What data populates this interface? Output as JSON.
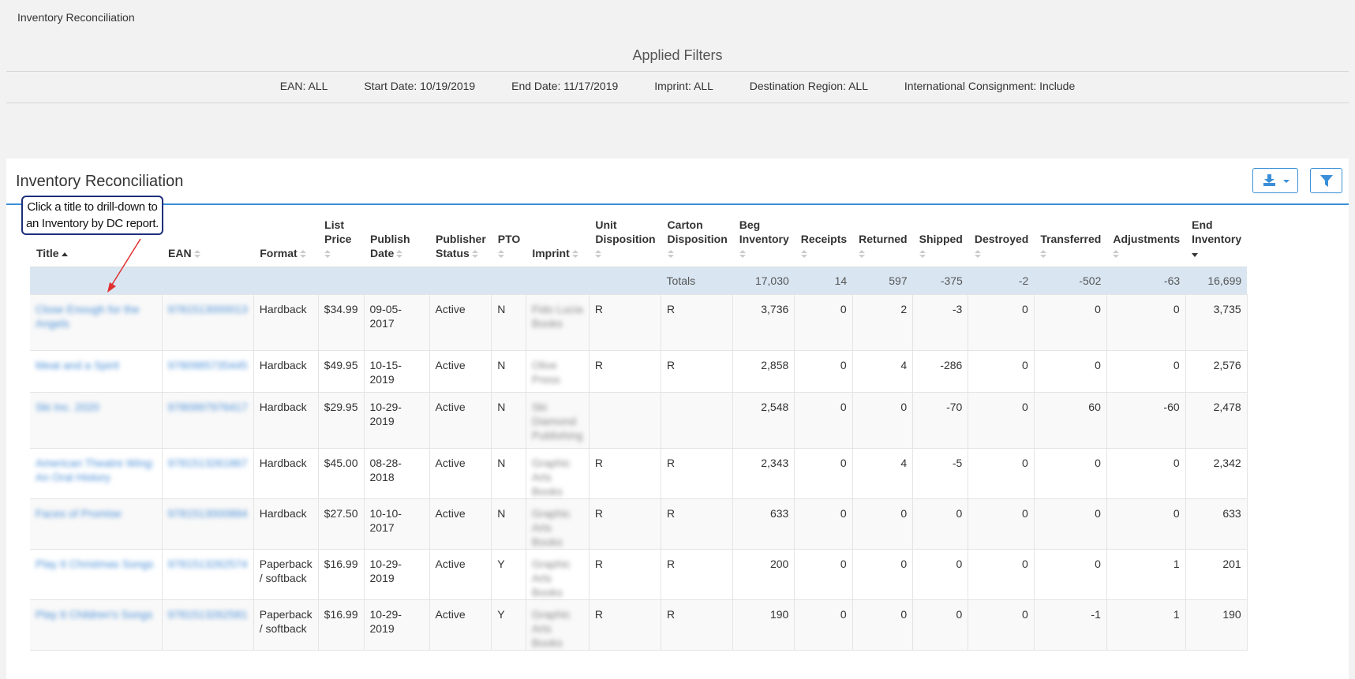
{
  "page": {
    "title": "Inventory Reconciliation",
    "filters_title": "Applied Filters",
    "filters": [
      "EAN: ALL",
      "Start Date: 10/19/2019",
      "End Date: 11/17/2019",
      "Imprint: ALL",
      "Destination Region: ALL",
      "International Consignment: Include"
    ]
  },
  "panel": {
    "title": "Inventory Reconciliation",
    "export_icon": "download-icon",
    "filter_icon": "filter-funnel-icon"
  },
  "callout": {
    "text": "Click a title to drill-down to an Inventory by DC report."
  },
  "table": {
    "headers": {
      "title": "Title",
      "ean": "EAN",
      "format": "Format",
      "list_price": "List Price",
      "publish_date": "Publish Date",
      "publisher_status": "Publisher Status",
      "pto": "PTO",
      "imprint": "Imprint",
      "unit_disposition": "Unit Disposition",
      "carton_disposition": "Carton Disposition",
      "beg_inventory": "Beg Inventory",
      "receipts": "Receipts",
      "returned": "Returned",
      "shipped": "Shipped",
      "destroyed": "Destroyed",
      "transferred": "Transferred",
      "adjustments": "Adjustments",
      "end_inventory": "End Inventory"
    },
    "totals": {
      "label": "Totals",
      "beg_inventory": "17,030",
      "receipts": "14",
      "returned": "597",
      "shipped": "-375",
      "destroyed": "-2",
      "transferred": "-502",
      "adjustments": "-63",
      "end_inventory": "16,699"
    },
    "rows": [
      {
        "title": "Close Enough for the Angels",
        "ean": "9781513000013",
        "format": "Hardback",
        "list_price": "$34.99",
        "publish_date": "09-05-2017",
        "status": "Active",
        "pto": "N",
        "imprint": "Fido Lucia Books",
        "unit": "R",
        "carton": "R",
        "beg": "3,736",
        "receipts": "0",
        "returned": "2",
        "shipped": "-3",
        "destroyed": "0",
        "transferred": "0",
        "adjustments": "0",
        "end": "3,735"
      },
      {
        "title": "Meat and a Spirit",
        "ean": "9780985735445",
        "format": "Hardback",
        "list_price": "$49.95",
        "publish_date": "10-15-2019",
        "status": "Active",
        "pto": "N",
        "imprint": "Olive Press",
        "unit": "R",
        "carton": "R",
        "beg": "2,858",
        "receipts": "0",
        "returned": "4",
        "shipped": "-286",
        "destroyed": "0",
        "transferred": "0",
        "adjustments": "0",
        "end": "2,576"
      },
      {
        "title": "Ski Inc. 2020",
        "ean": "9780997976417",
        "format": "Hardback",
        "list_price": "$29.95",
        "publish_date": "10-29-2019",
        "status": "Active",
        "pto": "N",
        "imprint": "Ski Diamond Publishing",
        "unit": "",
        "carton": "",
        "beg": "2,548",
        "receipts": "0",
        "returned": "0",
        "shipped": "-70",
        "destroyed": "0",
        "transferred": "60",
        "adjustments": "-60",
        "end": "2,478"
      },
      {
        "title": "American Theatre Wing: An Oral History",
        "ean": "9781513261867",
        "format": "Hardback",
        "list_price": "$45.00",
        "publish_date": "08-28-2018",
        "status": "Active",
        "pto": "N",
        "imprint": "Graphic Arts Books",
        "unit": "R",
        "carton": "R",
        "beg": "2,343",
        "receipts": "0",
        "returned": "4",
        "shipped": "-5",
        "destroyed": "0",
        "transferred": "0",
        "adjustments": "0",
        "end": "2,342"
      },
      {
        "title": "Faces of Promise",
        "ean": "9781513000884",
        "format": "Hardback",
        "list_price": "$27.50",
        "publish_date": "10-10-2017",
        "status": "Active",
        "pto": "N",
        "imprint": "Graphic Arts Books",
        "unit": "R",
        "carton": "R",
        "beg": "633",
        "receipts": "0",
        "returned": "0",
        "shipped": "0",
        "destroyed": "0",
        "transferred": "0",
        "adjustments": "0",
        "end": "633"
      },
      {
        "title": "Play It Christmas Songs",
        "ean": "9781513262574",
        "format": "Paperback / softback",
        "list_price": "$16.99",
        "publish_date": "10-29-2019",
        "status": "Active",
        "pto": "Y",
        "imprint": "Graphic Arts Books",
        "unit": "R",
        "carton": "R",
        "beg": "200",
        "receipts": "0",
        "returned": "0",
        "shipped": "0",
        "destroyed": "0",
        "transferred": "0",
        "adjustments": "1",
        "end": "201"
      },
      {
        "title": "Play It Children's Songs",
        "ean": "9781513262581",
        "format": "Paperback / softback",
        "list_price": "$16.99",
        "publish_date": "10-29-2019",
        "status": "Active",
        "pto": "Y",
        "imprint": "Graphic Arts Books",
        "unit": "R",
        "carton": "R",
        "beg": "190",
        "receipts": "0",
        "returned": "0",
        "shipped": "0",
        "destroyed": "0",
        "transferred": "-1",
        "adjustments": "1",
        "end": "190"
      }
    ]
  }
}
